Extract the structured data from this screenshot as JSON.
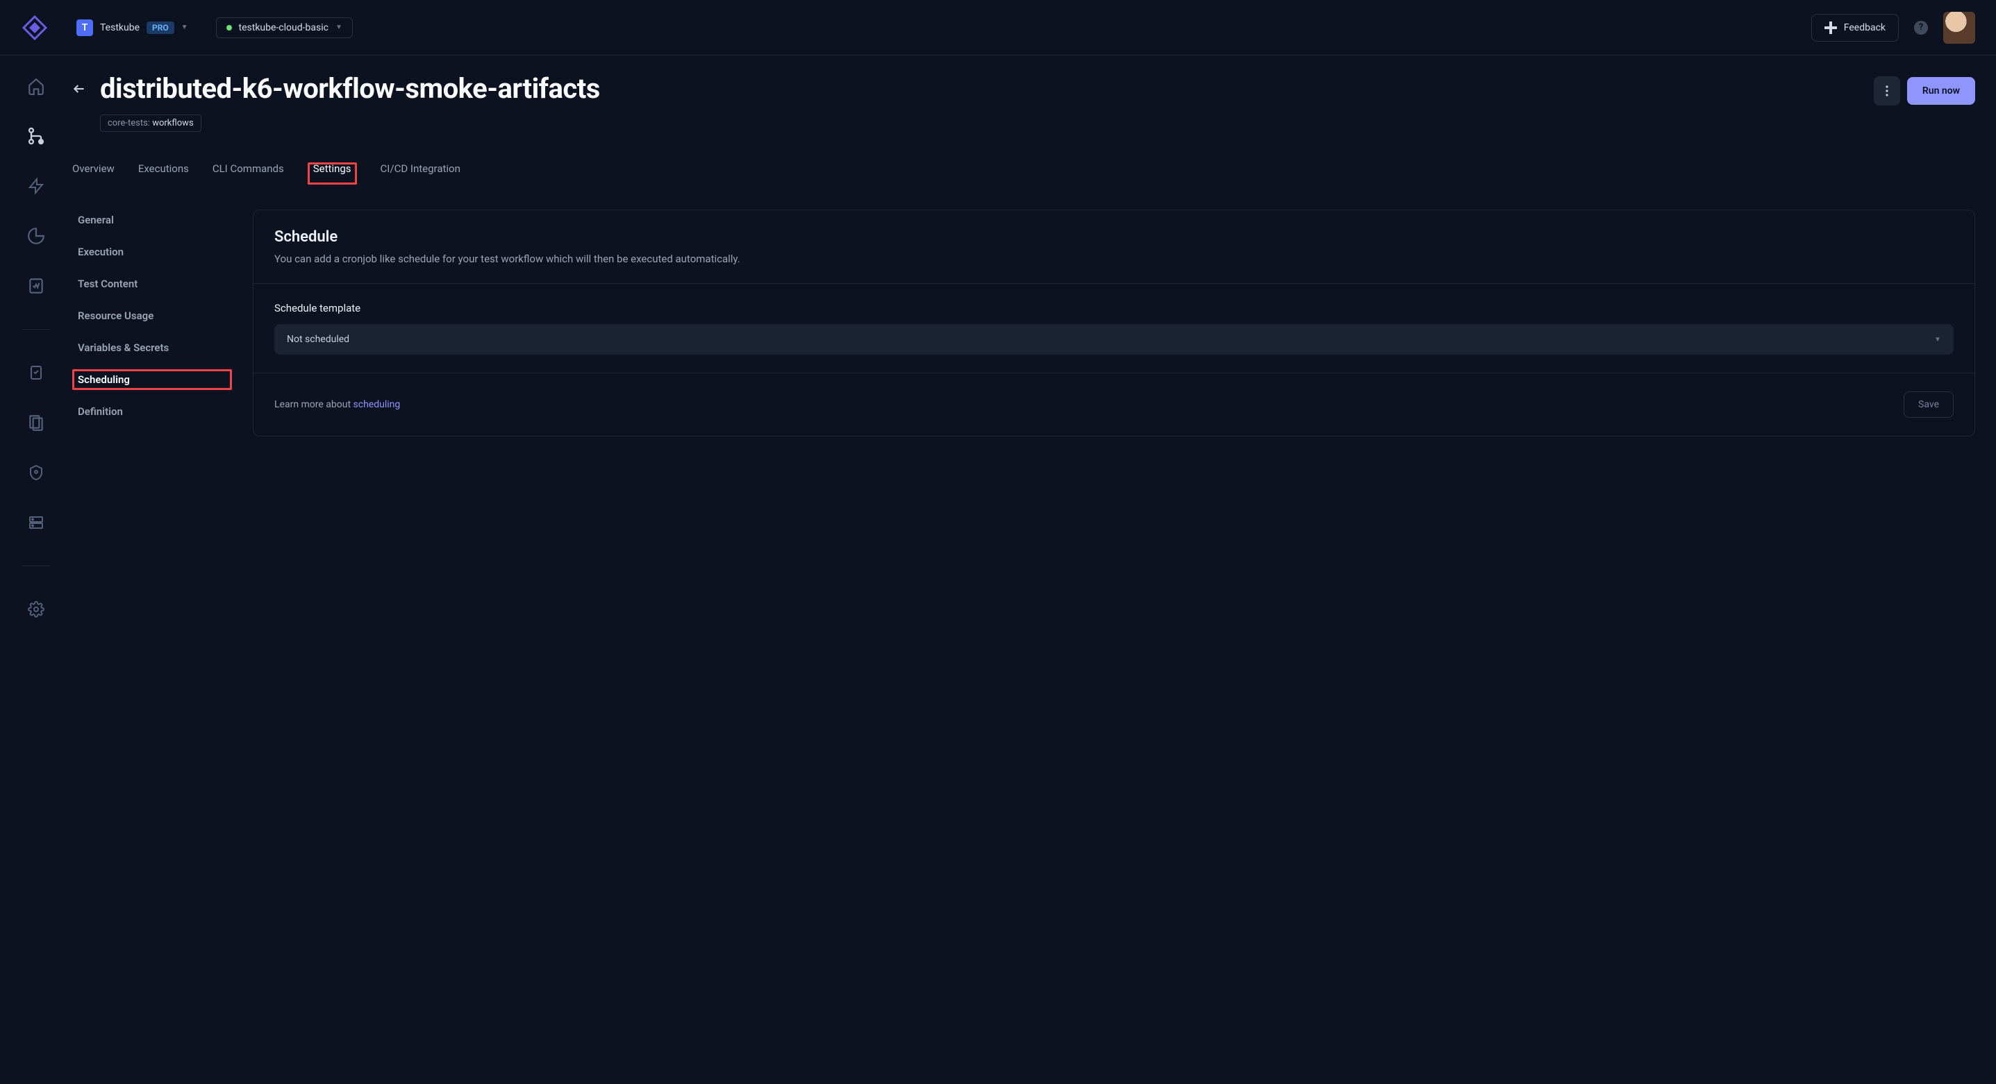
{
  "topbar": {
    "org_initial": "T",
    "org_name": "Testkube",
    "badge": "PRO",
    "env_name": "testkube-cloud-basic",
    "feedback_label": "Feedback",
    "help_glyph": "?"
  },
  "header": {
    "title": "distributed-k6-workflow-smoke-artifacts",
    "tag_key": "core-tests:",
    "tag_value": "workflows",
    "run_label": "Run now"
  },
  "tabs": [
    {
      "label": "Overview",
      "active": false
    },
    {
      "label": "Executions",
      "active": false
    },
    {
      "label": "CLI Commands",
      "active": false
    },
    {
      "label": "Settings",
      "active": true,
      "highlighted": true
    },
    {
      "label": "CI/CD Integration",
      "active": false
    }
  ],
  "settings_nav": [
    {
      "label": "General",
      "active": false
    },
    {
      "label": "Execution",
      "active": false
    },
    {
      "label": "Test Content",
      "active": false
    },
    {
      "label": "Resource Usage",
      "active": false
    },
    {
      "label": "Variables & Secrets",
      "active": false
    },
    {
      "label": "Scheduling",
      "active": true,
      "highlighted": true
    },
    {
      "label": "Definition",
      "active": false
    }
  ],
  "panel": {
    "title": "Schedule",
    "description": "You can add a cronjob like schedule for your test workflow which will then be executed automatically.",
    "field_label": "Schedule template",
    "selected": "Not scheduled",
    "learn_prefix": "Learn more about ",
    "learn_link": "scheduling",
    "save_label": "Save"
  }
}
